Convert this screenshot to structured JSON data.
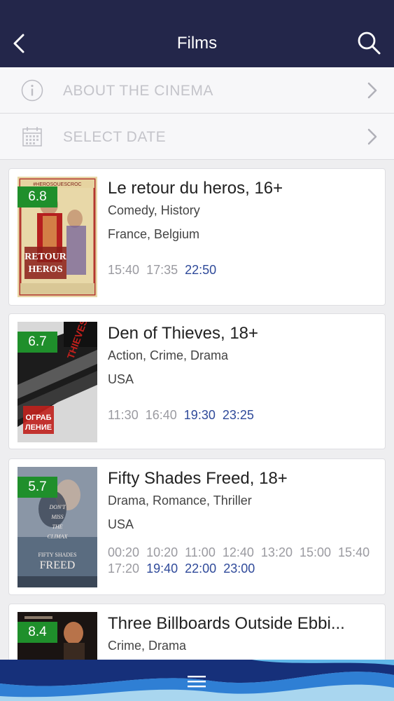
{
  "header": {
    "title": "Films"
  },
  "menu": {
    "about": "ABOUT THE CINEMA",
    "date": "SELECT DATE"
  },
  "films": [
    {
      "title": "Le retour du heros, 16+",
      "rating": "6.8",
      "genres": "Comedy, History",
      "country": "France, Belgium",
      "times": [
        [
          "15:40",
          false
        ],
        [
          "17:35",
          false
        ],
        [
          "22:50",
          true
        ]
      ]
    },
    {
      "title": "Den of Thieves, 18+",
      "rating": "6.7",
      "genres": "Action, Crime, Drama",
      "country": "USA",
      "times": [
        [
          "11:30",
          false
        ],
        [
          "16:40",
          false
        ],
        [
          "19:30",
          true
        ],
        [
          "23:25",
          true
        ]
      ]
    },
    {
      "title": "Fifty Shades Freed, 18+",
      "rating": "5.7",
      "genres": "Drama, Romance, Thriller",
      "country": "USA",
      "times": [
        [
          "00:20",
          false
        ],
        [
          "10:20",
          false
        ],
        [
          "11:00",
          false
        ],
        [
          "12:40",
          false
        ],
        [
          "13:20",
          false
        ],
        [
          "15:00",
          false
        ],
        [
          "15:40",
          false
        ],
        [
          "17:20",
          false
        ],
        [
          "19:40",
          true
        ],
        [
          "22:00",
          true
        ],
        [
          "23:00",
          true
        ]
      ]
    },
    {
      "title": "Three Billboards Outside Ebbi...",
      "rating": "8.4",
      "genres": "Crime, Drama",
      "country": "",
      "times": []
    }
  ],
  "poster_text": {
    "film1_hashtag": "#HEROSOUESCROC",
    "film1_name": "LE RETOUR DU HEROS",
    "film2_name": "DEN OF THIEVES",
    "film3_name": "FIFTY SHADES FREED"
  },
  "colors": {
    "header_bg": "#23264a",
    "rating_bg": "#1f8f2b",
    "time_active": "#2f4a9a",
    "time_inactive": "#9a9aa0"
  },
  "icons": {
    "back": "chevron-left-icon",
    "search": "search-icon",
    "info": "info-icon",
    "calendar": "calendar-icon",
    "chevron": "chevron-right-icon",
    "menu": "hamburger-menu-icon"
  }
}
